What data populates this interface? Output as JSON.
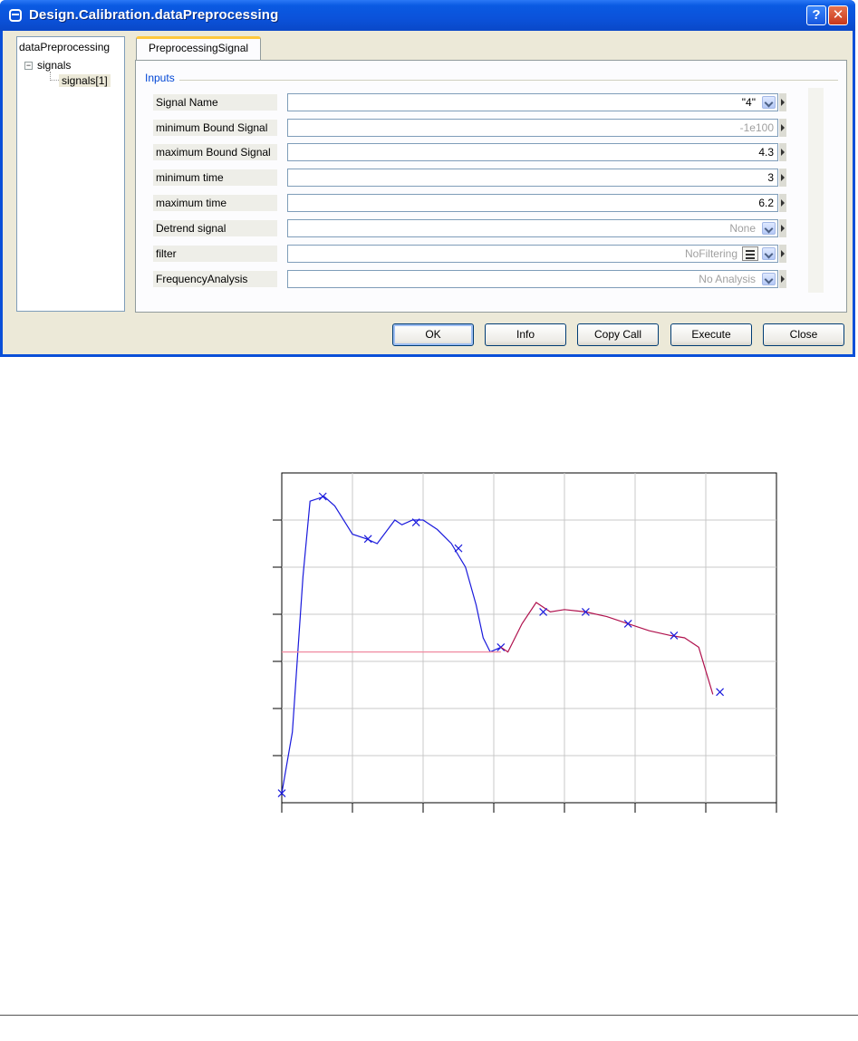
{
  "window": {
    "title": "Design.Calibration.dataPreprocessing",
    "help_label": "?",
    "close_label": "✕",
    "icon": "window-icon"
  },
  "tree": {
    "root": "dataPreprocessing",
    "expander": "−",
    "group": "signals",
    "selected_child": "signals[1]"
  },
  "tab": {
    "label": "PreprocessingSignal"
  },
  "inputs": {
    "legend": "Inputs",
    "rows": [
      {
        "label": "Signal Name",
        "value": "\"4\""
      },
      {
        "label": "minimum Bound Signal",
        "value": "-1e100"
      },
      {
        "label": "maximum Bound Signal",
        "value": "4.3"
      },
      {
        "label": "minimum time",
        "value": "3"
      },
      {
        "label": "maximum time",
        "value": "6.2"
      },
      {
        "label": "Detrend signal",
        "value": "None"
      },
      {
        "label": "filter",
        "value": "NoFiltering"
      },
      {
        "label": "FrequencyAnalysis",
        "value": "No Analysis"
      }
    ]
  },
  "buttons": {
    "ok": "OK",
    "info": "Info",
    "copy_call": "Copy Call",
    "execute": "Execute",
    "close": "Close"
  },
  "chart_data": {
    "type": "line",
    "title": "",
    "xlabel": "",
    "ylabel": "",
    "x_ticks": 7,
    "y_ticks": 6,
    "grid": true,
    "xlim": [
      0,
      7
    ],
    "ylim": [
      0,
      7
    ],
    "series": [
      {
        "color": "#1a1adc",
        "points": [
          [
            0,
            0.2
          ],
          [
            0.15,
            1.5
          ],
          [
            0.3,
            4.8
          ],
          [
            0.4,
            6.4
          ],
          [
            0.6,
            6.5
          ],
          [
            0.75,
            6.3
          ],
          [
            1.0,
            5.7
          ],
          [
            1.2,
            5.6
          ],
          [
            1.35,
            5.5
          ],
          [
            1.5,
            5.8
          ],
          [
            1.6,
            6.0
          ],
          [
            1.7,
            5.9
          ],
          [
            1.85,
            6.0
          ],
          [
            2.0,
            6.0
          ],
          [
            2.2,
            5.8
          ],
          [
            2.4,
            5.5
          ],
          [
            2.6,
            5.0
          ],
          [
            2.75,
            4.2
          ],
          [
            2.85,
            3.5
          ],
          [
            2.95,
            3.2
          ],
          [
            3.1,
            3.3
          ]
        ],
        "markers": [
          [
            0,
            0.2
          ],
          [
            0.58,
            6.5
          ],
          [
            1.22,
            5.6
          ],
          [
            1.9,
            5.95
          ],
          [
            2.5,
            5.4
          ],
          [
            3.1,
            3.3
          ]
        ]
      },
      {
        "color": "#b0124e",
        "points": [
          [
            3.1,
            3.3
          ],
          [
            3.2,
            3.2
          ],
          [
            3.4,
            3.8
          ],
          [
            3.6,
            4.25
          ],
          [
            3.8,
            4.05
          ],
          [
            4.0,
            4.1
          ],
          [
            4.3,
            4.05
          ],
          [
            4.6,
            3.95
          ],
          [
            4.9,
            3.8
          ],
          [
            5.2,
            3.65
          ],
          [
            5.5,
            3.55
          ],
          [
            5.7,
            3.5
          ],
          [
            5.9,
            3.3
          ],
          [
            6.0,
            2.8
          ],
          [
            6.1,
            2.3
          ]
        ],
        "markers": [
          [
            3.7,
            4.05
          ],
          [
            4.3,
            4.05
          ],
          [
            4.9,
            3.8
          ],
          [
            5.55,
            3.55
          ],
          [
            6.2,
            2.35
          ]
        ]
      },
      {
        "color": "#f08aa0",
        "points": [
          [
            0,
            3.2
          ],
          [
            3.1,
            3.2
          ]
        ],
        "markers": []
      }
    ]
  }
}
